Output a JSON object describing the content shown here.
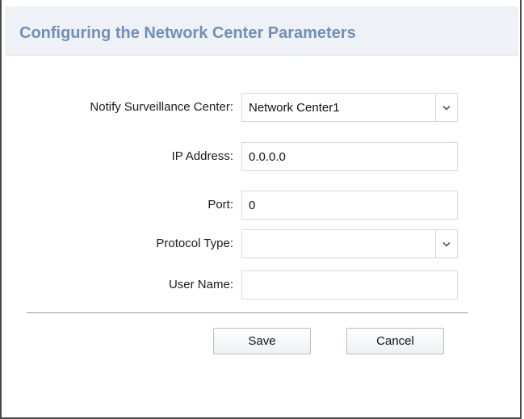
{
  "dialog": {
    "title": "Configuring the Network Center Parameters"
  },
  "form": {
    "notify_center": {
      "label": "Notify Surveillance Center:",
      "value": "Network Center1"
    },
    "ip_address": {
      "label": "IP Address:",
      "value": "0.0.0.0"
    },
    "port": {
      "label": "Port:",
      "value": "0"
    },
    "protocol_type": {
      "label": "Protocol Type:",
      "value": ""
    },
    "user_name": {
      "label": "User Name:",
      "value": ""
    }
  },
  "buttons": {
    "save_label": "Save",
    "cancel_label": "Cancel"
  },
  "icons": {
    "dropdown": "chevron-down-icon"
  }
}
